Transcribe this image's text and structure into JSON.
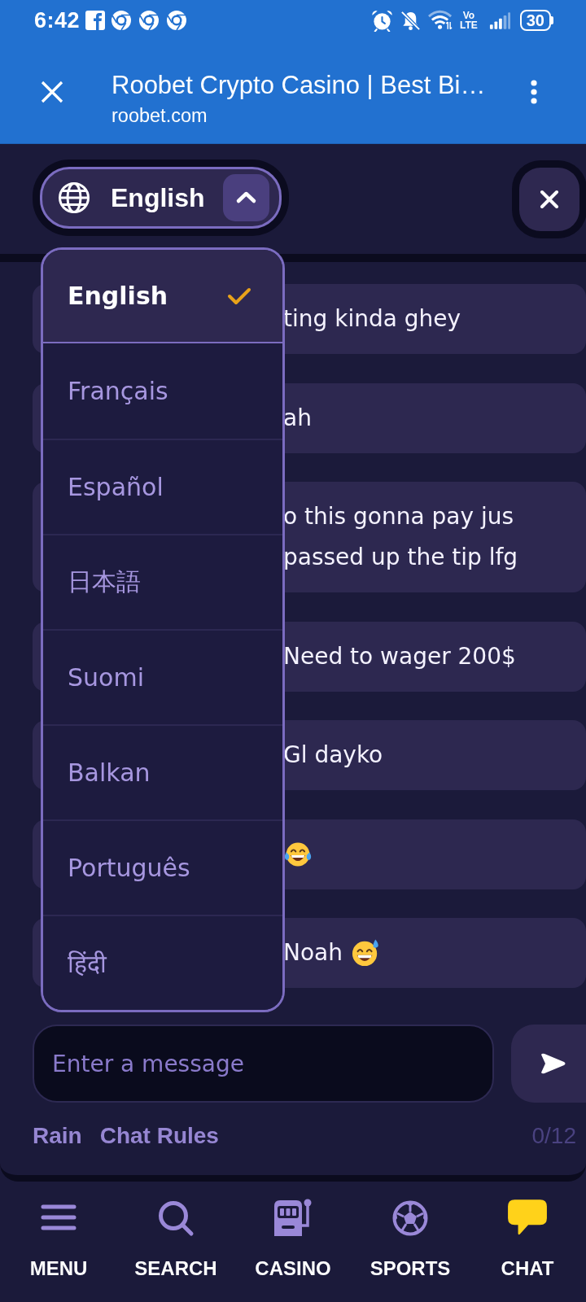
{
  "status_bar": {
    "time": "6:42",
    "network_label": [
      "Vo",
      "LTE"
    ],
    "battery": "30"
  },
  "browser": {
    "title": "Roobet Crypto Casino | Best Bi…",
    "url": "roobet.com"
  },
  "language_selector": {
    "label": "English",
    "expanded": true
  },
  "language_menu": {
    "items": [
      {
        "label": "English",
        "selected": true
      },
      {
        "label": "Français",
        "selected": false
      },
      {
        "label": "Español",
        "selected": false
      },
      {
        "label": "日本語",
        "selected": false
      },
      {
        "label": "Suomi",
        "selected": false
      },
      {
        "label": "Balkan",
        "selected": false
      },
      {
        "label": "Português",
        "selected": false
      },
      {
        "label": "हिंदी",
        "selected": false
      }
    ]
  },
  "messages": [
    {
      "kind": "plain",
      "text": "ting kinda ghey"
    },
    {
      "kind": "plain",
      "text": "ah"
    },
    {
      "kind": "plain",
      "text": "o this gonna pay jus passed up the tip lfg"
    },
    {
      "kind": "plain",
      "text": "Need to wager 200$"
    },
    {
      "kind": "plain",
      "text": "Gl dayko"
    },
    {
      "kind": "laugh"
    },
    {
      "kind": "sweat",
      "text": "Noah"
    }
  ],
  "composer": {
    "placeholder": "Enter a message",
    "links": [
      "Rain",
      "Chat Rules"
    ],
    "counter": "0/12"
  },
  "bottom_nav": {
    "items": [
      {
        "kind": "menu",
        "label": "MENU",
        "selected": false
      },
      {
        "kind": "search",
        "label": "SEARCH",
        "selected": false
      },
      {
        "kind": "casino",
        "label": "CASINO",
        "selected": false
      },
      {
        "kind": "sports",
        "label": "SPORTS",
        "selected": false
      },
      {
        "kind": "chat",
        "label": "CHAT",
        "selected": true
      }
    ]
  }
}
